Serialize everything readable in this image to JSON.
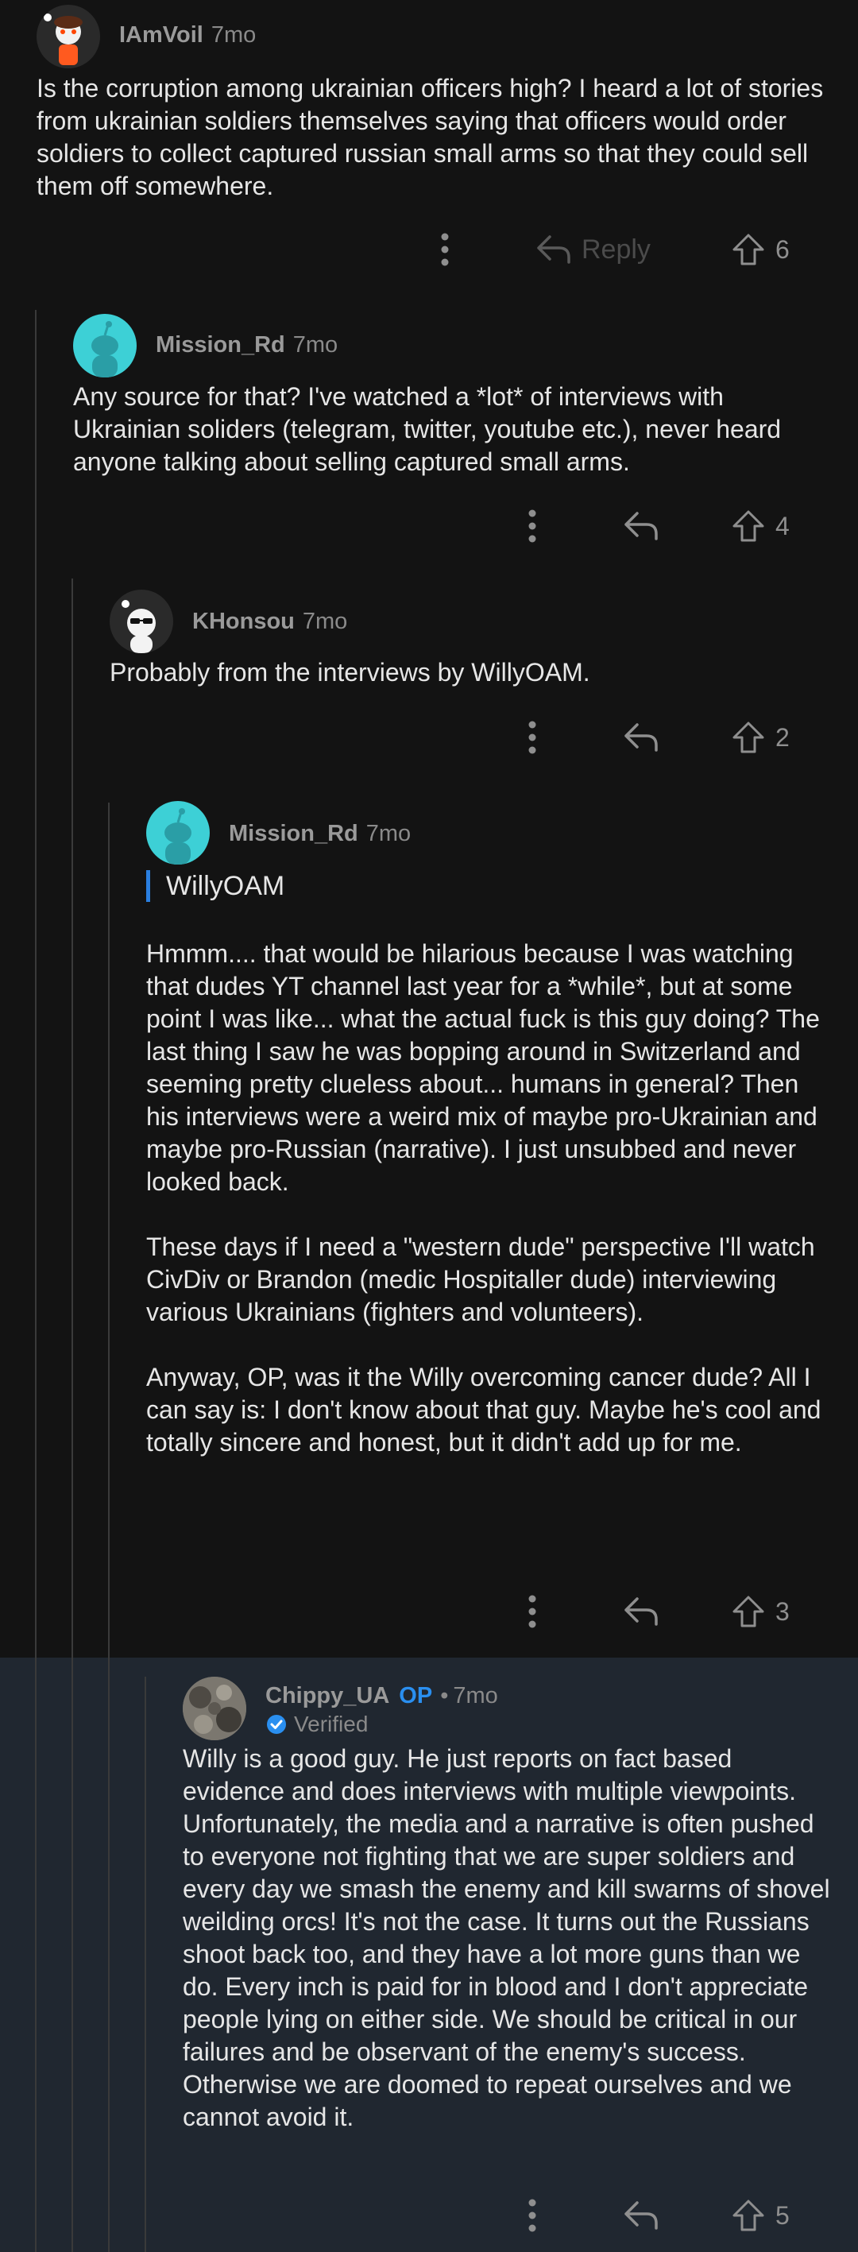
{
  "comments": [
    {
      "author": "IAmVoil",
      "age": "7mo",
      "body": "Is the corruption among ukrainian officers high? I heard a lot of stories from ukrainian soldiers themselves saying that officers would order soldiers to collect captured russian small arms so that they could sell them off somewhere.",
      "reply_label": "Reply",
      "score": "6"
    },
    {
      "author": "Mission_Rd",
      "age": "7mo",
      "body": "Any source for that? I've watched a *lot* of interviews with Ukrainian soliders (telegram, twitter, youtube etc.), never heard anyone talking about selling captured small arms.",
      "score": "4"
    },
    {
      "author": "KHonsou",
      "age": "7mo",
      "body": "Probably from the interviews by WillyOAM.",
      "score": "2"
    },
    {
      "author": "Mission_Rd",
      "age": "7mo",
      "quote": "WillyOAM",
      "body": "Hmmm.... that would be hilarious because I was watching that dudes YT channel last year for a *while*, but at some point I was like... what the actual fuck is this guy doing? The last thing I saw he was bopping around in Switzerland and seeming pretty clueless about... humans in general? Then his interviews were a weird mix of maybe pro-Ukrainian and maybe pro-Russian (narrative). I just unsubbed and never looked back.\n\nThese days if I need a \"western dude\" perspective I'll watch CivDiv or Brandon (medic Hospitaller dude) interviewing various Ukrainians (fighters and volunteers).\n\nAnyway, OP, was it the Willy overcoming cancer dude? All I can say is: I don't know about that guy. Maybe he's cool and totally sincere and honest, but it didn't add up for me.",
      "score": "3"
    },
    {
      "author": "Chippy_UA",
      "op_badge": "OP",
      "separator": "•",
      "age": "7mo",
      "verified": "Verified",
      "body": "Willy is a good guy. He just reports on fact based evidence and does interviews with multiple viewpoints. Unfortunately, the media and a narrative is often pushed to everyone not fighting that we are super soldiers and every day we smash the enemy and kill swarms of shovel weilding orcs! It's not the case. It turns out the Russians shoot back too, and they have a lot more guns than we do. Every inch is paid for in blood and I don't appreciate people lying on either side. We should be critical in our failures and be observant of the enemy's success. Otherwise we are doomed to repeat ourselves and we cannot avoid it.",
      "score": "5"
    }
  ],
  "icons": {
    "more": "more-options-icon",
    "reply": "reply-arrow-icon",
    "upvote": "upvote-arrow-icon",
    "verified": "verified-check-icon"
  },
  "colors": {
    "background": "#131313",
    "op_highlight": "#202730",
    "op_badge": "#2a8ff0",
    "quote_bar": "#2a7fe0",
    "avatar_teal": "#3dd0d6"
  }
}
